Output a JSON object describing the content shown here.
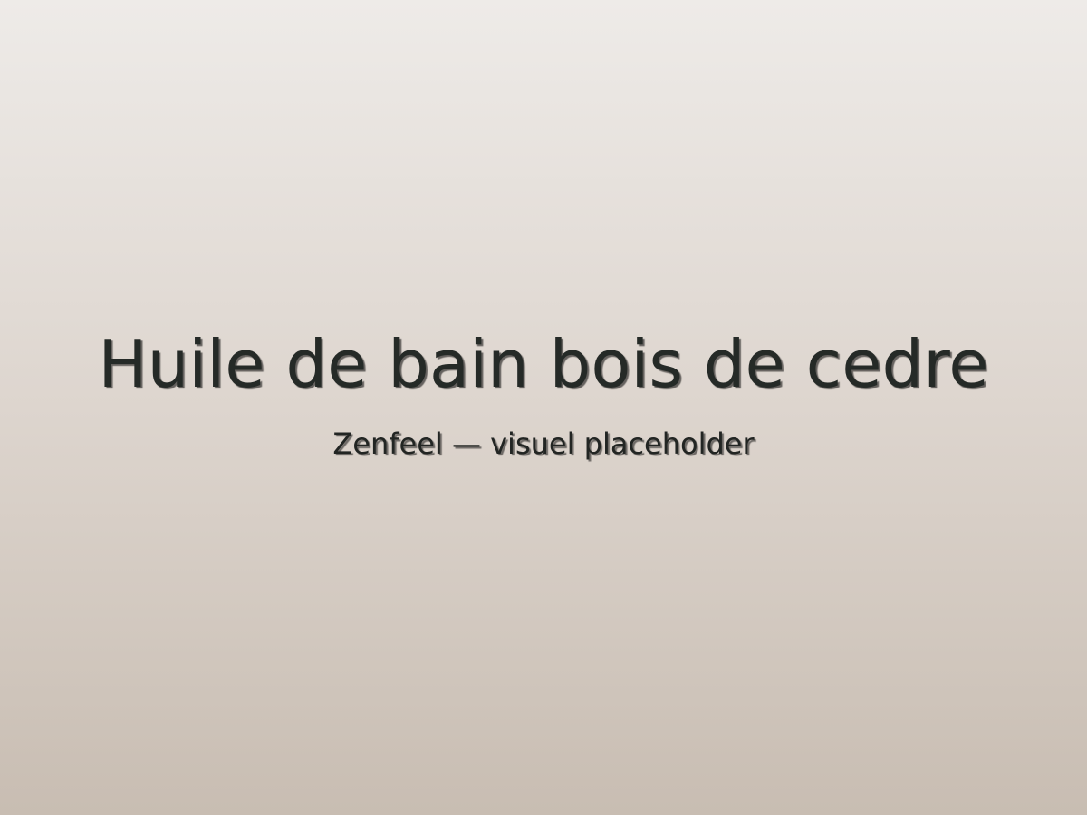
{
  "placeholder": {
    "title": "Huile de bain bois de cedre",
    "subtitle": "Zenfeel — visuel placeholder"
  }
}
